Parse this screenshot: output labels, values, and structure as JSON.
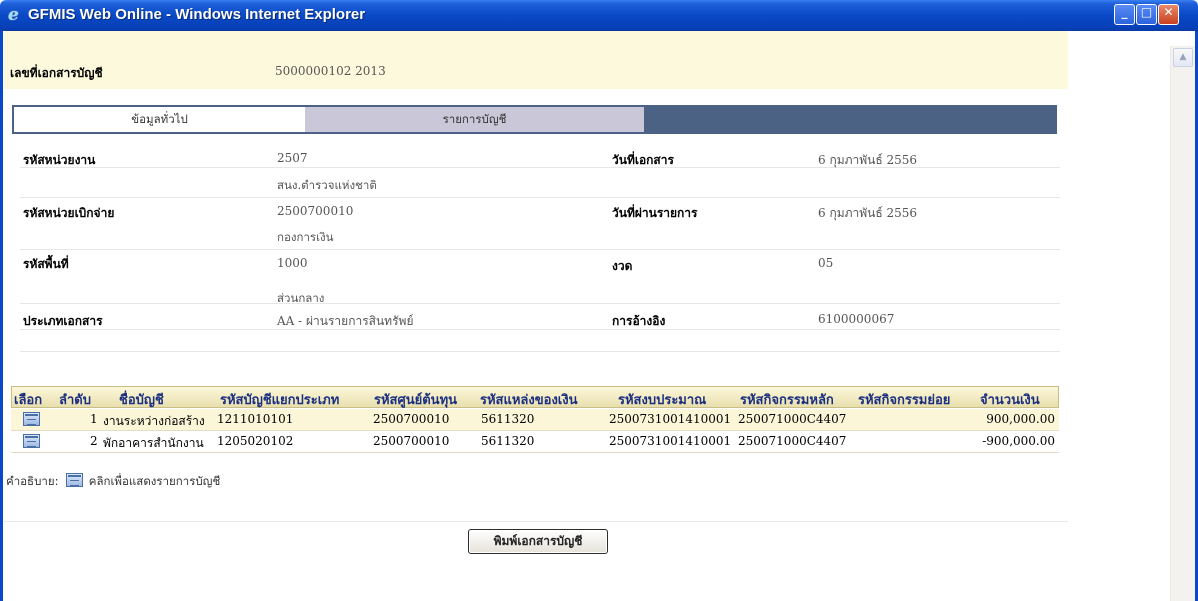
{
  "window": {
    "title": "GFMIS Web Online - Windows Internet Explorer",
    "buttons": {
      "minimize": "_",
      "maximize": "□",
      "close": "✕"
    }
  },
  "document_number": {
    "label": "เลขที่เอกสารบัญชี",
    "value": "5000000102  2013"
  },
  "tabs": [
    {
      "label": "ข้อมูลทั่วไป",
      "active": true
    },
    {
      "label": "รายการบัญชี",
      "active": false
    }
  ],
  "general_info": {
    "unit_code": {
      "label": "รหัสหน่วยงาน",
      "value": "2507",
      "sub": "สนง.ตำรวจแห่งชาติ"
    },
    "doc_date": {
      "label": "วันที่เอกสาร",
      "value": "6 กุมภาพันธ์ 2556"
    },
    "disbursing_unit": {
      "label": "รหัสหน่วยเบิกจ่าย",
      "value": "2500700010",
      "sub": "กองการเงิน"
    },
    "posting_date": {
      "label": "วันที่ผ่านรายการ",
      "value": "6 กุมภาพันธ์ 2556"
    },
    "area_code": {
      "label": "รหัสพื้นที่",
      "value": "1000",
      "sub": "ส่วนกลาง"
    },
    "period": {
      "label": "งวด",
      "value": "05"
    },
    "doc_type": {
      "label": "ประเภทเอกสาร",
      "value": "AA - ผ่านรายการสินทรัพย์"
    },
    "reference": {
      "label": "การอ้างอิง",
      "value": "6100000067"
    }
  },
  "account_table": {
    "headers": [
      "เลือก",
      "ลำดับ",
      "ชื่อบัญชี",
      "รหัสบัญชีแยกประเภท",
      "รหัสศูนย์ต้นทุน",
      "รหัสแหล่งของเงิน",
      "รหัสงบประมาณ",
      "รหัสกิจกรรมหลัก",
      "รหัสกิจกรรมย่อย",
      "จำนวนเงิน"
    ],
    "rows": [
      {
        "seq": "1",
        "name": "งานระหว่างก่อสร้าง",
        "gl": "1211010101",
        "cost_center": "2500700010",
        "fund": "5611320",
        "budget": "2500731001410001",
        "main_activity": "250071000C4407",
        "sub_activity": "",
        "amount": "900,000.00"
      },
      {
        "seq": "2",
        "name": "พักอาคารสำนักงาน",
        "gl": "1205020102",
        "cost_center": "2500700010",
        "fund": "5611320",
        "budget": "2500731001410001",
        "main_activity": "250071000C4407",
        "sub_activity": "",
        "amount": "-900,000.00"
      }
    ],
    "row_icon": "document-list-icon"
  },
  "legend": {
    "prefix": "คำอธิบาย:",
    "text": "คลิกเพื่อแสดงรายการบัญชี"
  },
  "print_button": {
    "label": "พิมพ์เอกสารบัญชี"
  },
  "colors": {
    "titlebar": "#0a49c6",
    "doc_bar_bg": "#fdf9dd",
    "tab_strip": "#4b6284",
    "header_text": "#1b2f80",
    "row_highlight": "#fbf6d8"
  }
}
